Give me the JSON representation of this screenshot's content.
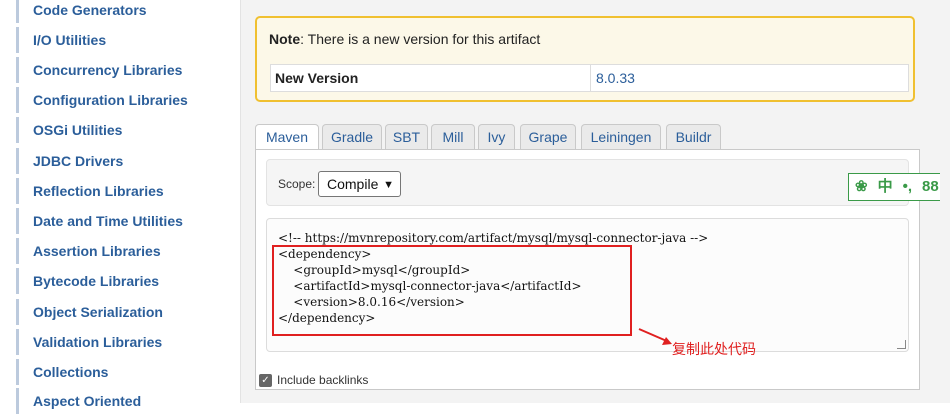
{
  "sidebar": {
    "items": [
      {
        "label": "Code Generators"
      },
      {
        "label": "I/O Utilities"
      },
      {
        "label": "Concurrency Libraries"
      },
      {
        "label": "Configuration Libraries"
      },
      {
        "label": "OSGi Utilities"
      },
      {
        "label": "JDBC Drivers"
      },
      {
        "label": "Reflection Libraries"
      },
      {
        "label": "Date and Time Utilities"
      },
      {
        "label": "Assertion Libraries"
      },
      {
        "label": "Bytecode Libraries"
      },
      {
        "label": "Object Serialization"
      },
      {
        "label": "Validation Libraries"
      },
      {
        "label": "Collections"
      },
      {
        "label": "Aspect Oriented"
      }
    ]
  },
  "note": {
    "prefix": "Note",
    "text": ": There is a new version for this artifact",
    "row_label": "New Version",
    "row_value": "8.0.33"
  },
  "tabs": [
    {
      "label": "Maven"
    },
    {
      "label": "Gradle"
    },
    {
      "label": "SBT"
    },
    {
      "label": "Mill"
    },
    {
      "label": "Ivy"
    },
    {
      "label": "Grape"
    },
    {
      "label": "Leiningen"
    },
    {
      "label": "Buildr"
    }
  ],
  "scope": {
    "label": "Scope:",
    "selected": "Compile"
  },
  "code": {
    "snippet": "<!-- https://mvnrepository.com/artifact/mysql/mysql-connector-java -->\n<dependency>\n    <groupId>mysql</groupId>\n    <artifactId>mysql-connector-java</artifactId>\n    <version>8.0.16</version>\n</dependency>"
  },
  "annotation": {
    "text": "复制此处代码",
    "color": "#e02020"
  },
  "backlinks": {
    "label": "Include backlinks",
    "checked": true
  },
  "ime": {
    "items": [
      "中",
      "•,",
      "88"
    ]
  },
  "colors": {
    "link": "#2b5e9a",
    "note_border": "#f0c030",
    "note_bg": "#fcf8e8",
    "ime_green": "#3a9a48"
  }
}
